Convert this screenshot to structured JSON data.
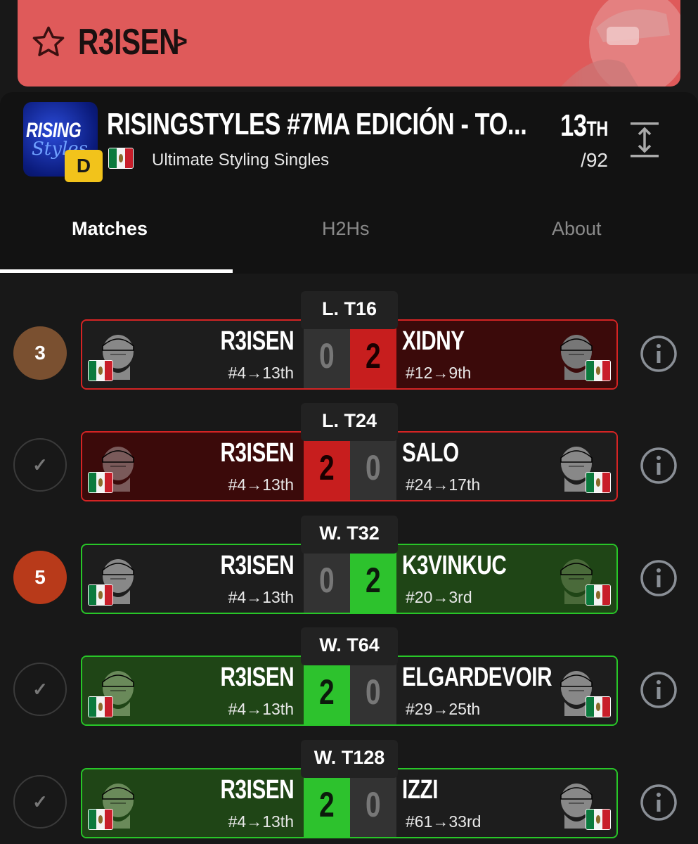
{
  "player": {
    "name": "R3ISEN",
    "icon": "star-icon",
    "banner_color": "#df5a5a"
  },
  "tournament": {
    "name": "RISINGSTYLES #7MA EDICIÓN - TO...",
    "event": "Ultimate Styling Singles",
    "tier_badge": "D",
    "logo_text_1": "RISING",
    "logo_text_2": "Styles",
    "placement": "13",
    "placement_suffix": "TH",
    "total": "/92"
  },
  "tabs": [
    {
      "label": "Matches",
      "active": true
    },
    {
      "label": "H2Hs",
      "active": false
    },
    {
      "label": "About",
      "active": false
    }
  ],
  "matches": [
    {
      "round": "L. T16",
      "status": "3",
      "status_type": "brown",
      "left": {
        "name": "R3ISEN",
        "seed": "#4→13th",
        "score": "0"
      },
      "right": {
        "name": "XIDNY",
        "seed": "#12→9th",
        "score": "2"
      },
      "winner": "right"
    },
    {
      "round": "L. T24",
      "status": "✓",
      "status_type": "check",
      "left": {
        "name": "R3ISEN",
        "seed": "#4→13th",
        "score": "2"
      },
      "right": {
        "name": "SALO",
        "seed": "#24→17th",
        "score": "0"
      },
      "winner": "left"
    },
    {
      "round": "W. T32",
      "status": "5",
      "status_type": "orange",
      "left": {
        "name": "R3ISEN",
        "seed": "#4→13th",
        "score": "0"
      },
      "right": {
        "name": "K3VINKUC",
        "seed": "#20→3rd",
        "score": "2"
      },
      "winner": "right"
    },
    {
      "round": "W. T64",
      "status": "✓",
      "status_type": "check",
      "left": {
        "name": "R3ISEN",
        "seed": "#4→13th",
        "score": "2"
      },
      "right": {
        "name": "ELGARDEVOIR",
        "seed": "#29→25th",
        "score": "0"
      },
      "winner": "left"
    },
    {
      "round": "W. T128",
      "status": "✓",
      "status_type": "check",
      "left": {
        "name": "R3ISEN",
        "seed": "#4→13th",
        "score": "2"
      },
      "right": {
        "name": "IZZI",
        "seed": "#61→33rd",
        "score": "0"
      },
      "winner": "left"
    }
  ]
}
